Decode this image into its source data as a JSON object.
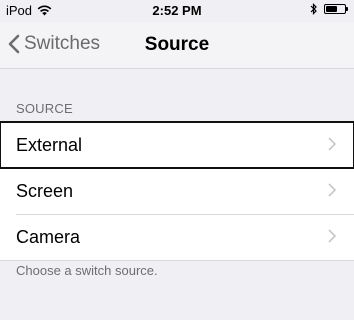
{
  "status_bar": {
    "carrier": "iPod",
    "time": "2:52 PM"
  },
  "nav": {
    "back_label": "Switches",
    "title": "Source"
  },
  "section": {
    "header": "SOURCE",
    "items": [
      {
        "label": "External",
        "selected": true
      },
      {
        "label": "Screen",
        "selected": false
      },
      {
        "label": "Camera",
        "selected": false
      }
    ],
    "footer": "Choose a switch source."
  },
  "colors": {
    "background": "#efeff4",
    "cell_background": "#ffffff",
    "secondary_text": "#6d6d72",
    "chevron": "#c7c7cc",
    "selection_outline": "#111111"
  },
  "icons": [
    "wifi-icon",
    "bluetooth-icon",
    "battery-icon",
    "back-chevron-icon",
    "disclosure-chevron-icon"
  ]
}
